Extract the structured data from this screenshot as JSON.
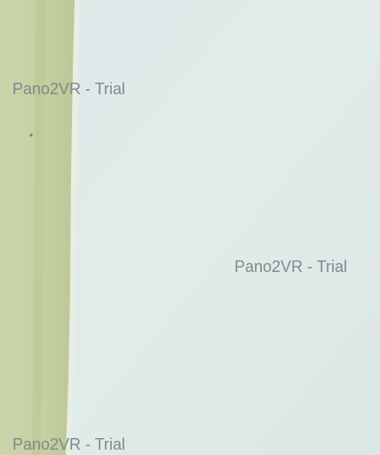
{
  "scene": {
    "colors": {
      "wall_left": "#c9d3a9",
      "wall_left_shadow": "#b8c392",
      "wall_right": "#dde9e7",
      "wall_right_light": "#e4eeec",
      "seam_highlight": "#eef3ea"
    }
  },
  "watermarks": [
    {
      "text": "Pano2VR - Trial"
    },
    {
      "text": "Pano2VR - Trial"
    },
    {
      "text": "Pano2VR - Trial"
    }
  ]
}
